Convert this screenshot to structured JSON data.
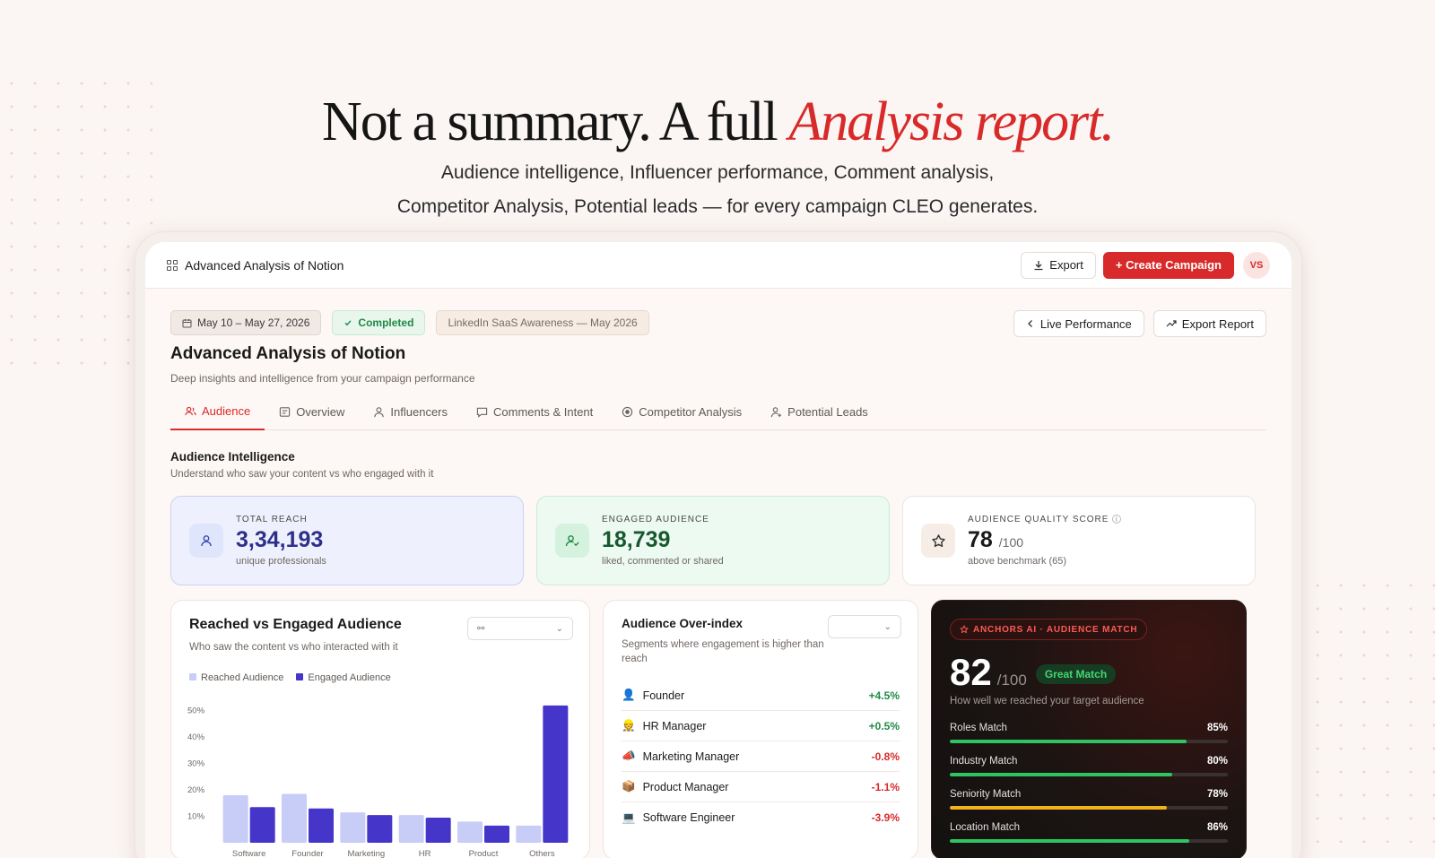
{
  "hero": {
    "title_plain": "Not a summary. A full ",
    "title_accent": "Analysis report.",
    "subtitle_line1": "Audience intelligence, Influencer performance, Comment analysis,",
    "subtitle_line2": "Competitor Analysis, Potential leads — for every campaign CLEO generates."
  },
  "topbar": {
    "title": "Advanced Analysis of Notion",
    "export_label": "Export",
    "create_label": "+ Create Campaign",
    "avatar_initials": "VS"
  },
  "header": {
    "date_range": "May 10 – May 27, 2026",
    "status": "Completed",
    "campaign": "LinkedIn SaaS Awareness — May 2026",
    "live_performance_label": "Live Performance",
    "export_report_label": "Export Report",
    "title": "Advanced Analysis of Notion",
    "description": "Deep insights and intelligence from your campaign performance"
  },
  "tabs": [
    {
      "label": "Audience",
      "active": true
    },
    {
      "label": "Overview"
    },
    {
      "label": "Influencers"
    },
    {
      "label": "Comments & Intent"
    },
    {
      "label": "Competitor Analysis"
    },
    {
      "label": "Potential Leads"
    }
  ],
  "section": {
    "title": "Audience Intelligence",
    "description": "Understand who saw your content vs who engaged with it"
  },
  "kpis": {
    "reach": {
      "label": "TOTAL REACH",
      "value": "3,34,193",
      "sub": "unique professionals"
    },
    "engaged": {
      "label": "ENGAGED AUDIENCE",
      "value": "18,739",
      "sub": "liked, commented or shared"
    },
    "quality": {
      "label": "AUDIENCE QUALITY SCORE",
      "value": "78",
      "of": "/100",
      "sub": "above benchmark (65)"
    }
  },
  "reach_chart": {
    "title": "Reached vs Engaged Audience",
    "description": "Who saw the content vs who interacted with it",
    "dropdown_value": "",
    "legend_reached": "Reached Audience",
    "legend_engaged": "Engaged Audience"
  },
  "chart_data": {
    "type": "bar",
    "categories": [
      "Software Engineer",
      "Founder",
      "Marketing Manager",
      "HR Manager",
      "Product Manager",
      "Others"
    ],
    "series": [
      {
        "name": "Reached Audience",
        "values": [
          18,
          18.5,
          11.5,
          10.5,
          8,
          6.5
        ],
        "color": "#c7cdf6"
      },
      {
        "name": "Engaged Audience",
        "values": [
          13.5,
          13,
          10.5,
          9.5,
          6.5,
          52
        ],
        "color": "#4535c9"
      }
    ],
    "yticks": [
      "10%",
      "20%",
      "30%",
      "40%",
      "50%"
    ],
    "ylim": [
      0,
      55
    ],
    "xlabel": "",
    "ylabel": ""
  },
  "over_index": {
    "title": "Audience Over-index",
    "description": "Segments where engagement is higher than reach",
    "dropdown_value": "",
    "rows": [
      {
        "emoji": "👤",
        "label": "Founder",
        "value": "+4.5%",
        "positive": true
      },
      {
        "emoji": "👷",
        "label": "HR Manager",
        "value": "+0.5%",
        "positive": true
      },
      {
        "emoji": "📣",
        "label": "Marketing Manager",
        "value": "-0.8%",
        "positive": false
      },
      {
        "emoji": "📦",
        "label": "Product Manager",
        "value": "-1.1%",
        "positive": false
      },
      {
        "emoji": "💻",
        "label": "Software Engineer",
        "value": "-3.9%",
        "positive": false
      }
    ]
  },
  "ai_match": {
    "badge": "ANCHORS AI · AUDIENCE MATCH",
    "score": "82",
    "of": "/100",
    "match_label": "Great Match",
    "description": "How well we reached your target audience",
    "bars": [
      {
        "label": "Roles Match",
        "value": "85%",
        "fraction": 0.85,
        "color": "#2fc462"
      },
      {
        "label": "Industry Match",
        "value": "80%",
        "fraction": 0.8,
        "color": "#2fc462"
      },
      {
        "label": "Seniority Match",
        "value": "78%",
        "fraction": 0.78,
        "color": "#f2b21c"
      },
      {
        "label": "Location Match",
        "value": "86%",
        "fraction": 0.86,
        "color": "#2fc462"
      }
    ]
  }
}
